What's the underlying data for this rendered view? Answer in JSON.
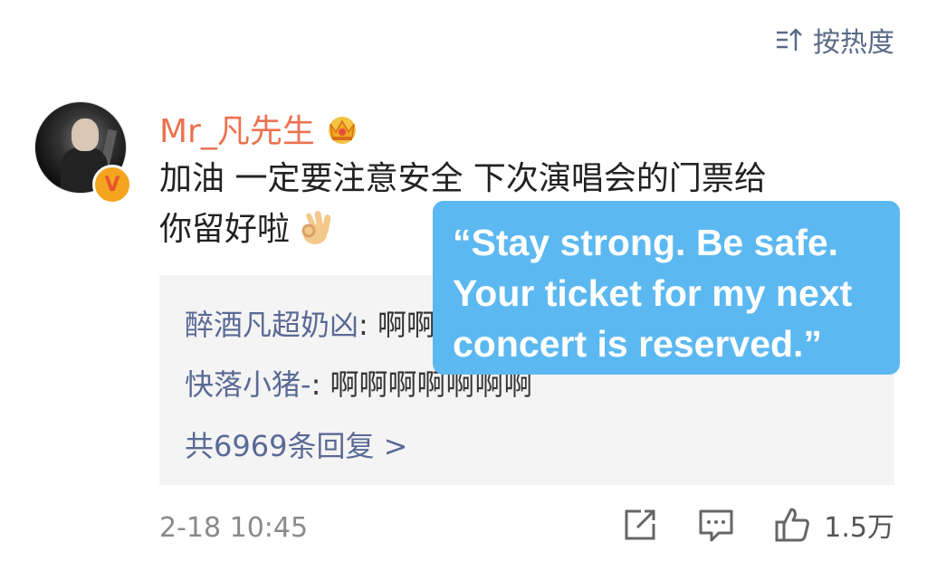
{
  "sort": {
    "label": "按热度",
    "icon": "sort-icon"
  },
  "comment": {
    "username": "Mr_凡先生",
    "badge_icon": "crown-icon",
    "verified_icon": "verified-v-icon",
    "text_line1": "加油 一定要注意安全 下次演唱会的门票给",
    "text_line2": "你留好啦",
    "emoji": "ok-hand-icon",
    "timestamp": "2-18 10:45",
    "like_count": "1.5万"
  },
  "replies": [
    {
      "name": "醉酒凡超奶凶",
      "separator": ":",
      "text": "啊啊啊啊啊啊啊啊"
    },
    {
      "name": "快落小猪-",
      "separator": ":",
      "text": "啊啊啊啊啊啊啊"
    }
  ],
  "reply_count": "共6969条回复 >",
  "translation_bubble": {
    "line1": "“Stay strong. Be safe.",
    "line2": "Your ticket for my next",
    "line3": "concert is reserved.”"
  },
  "actions": [
    "share-icon",
    "comment-icon",
    "like-icon"
  ],
  "colors": {
    "username": "#eb7350",
    "link": "#5a6a96",
    "bubble": "#5cb8f0",
    "reply_bg": "#f4f4f4"
  }
}
